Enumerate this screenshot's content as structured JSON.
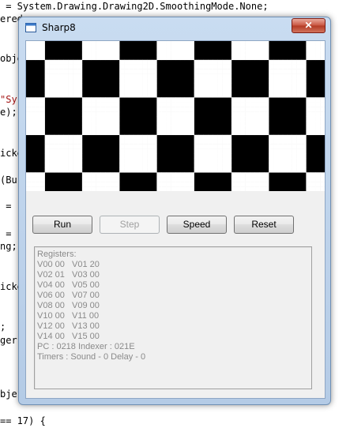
{
  "code": {
    "lines": [
      " = System.Drawing.Drawing2D.SmoothingMode.None;",
      "ered",
      "obje",
      "\"Sy",
      "e);",
      "icke",
      "(Bu",
      " = \"",
      " = \"",
      "ng;",
      "icke",
      ";",
      "ger",
      "bje",
      "== 17) {"
    ]
  },
  "window": {
    "title": "Sharp8",
    "close_label": "✕"
  },
  "buttons": {
    "run": "Run",
    "step": "Step",
    "speed": "Speed",
    "reset": "Reset"
  },
  "registers": {
    "header": "Registers:",
    "rows": [
      "V00 00   V01 20",
      "V02 01   V03 00",
      "V04 00   V05 00",
      "V06 00   V07 00",
      "V08 00   V09 00",
      "V10 00   V11 00",
      "V12 00   V13 00",
      "V14 00   V15 00"
    ],
    "pc_line": "PC : 0218 Indexer : 021E",
    "timers_line": "Timers : Sound - 0 Delay - 0"
  },
  "colors": {
    "display_on": "#ffffff",
    "display_off": "#000000"
  }
}
